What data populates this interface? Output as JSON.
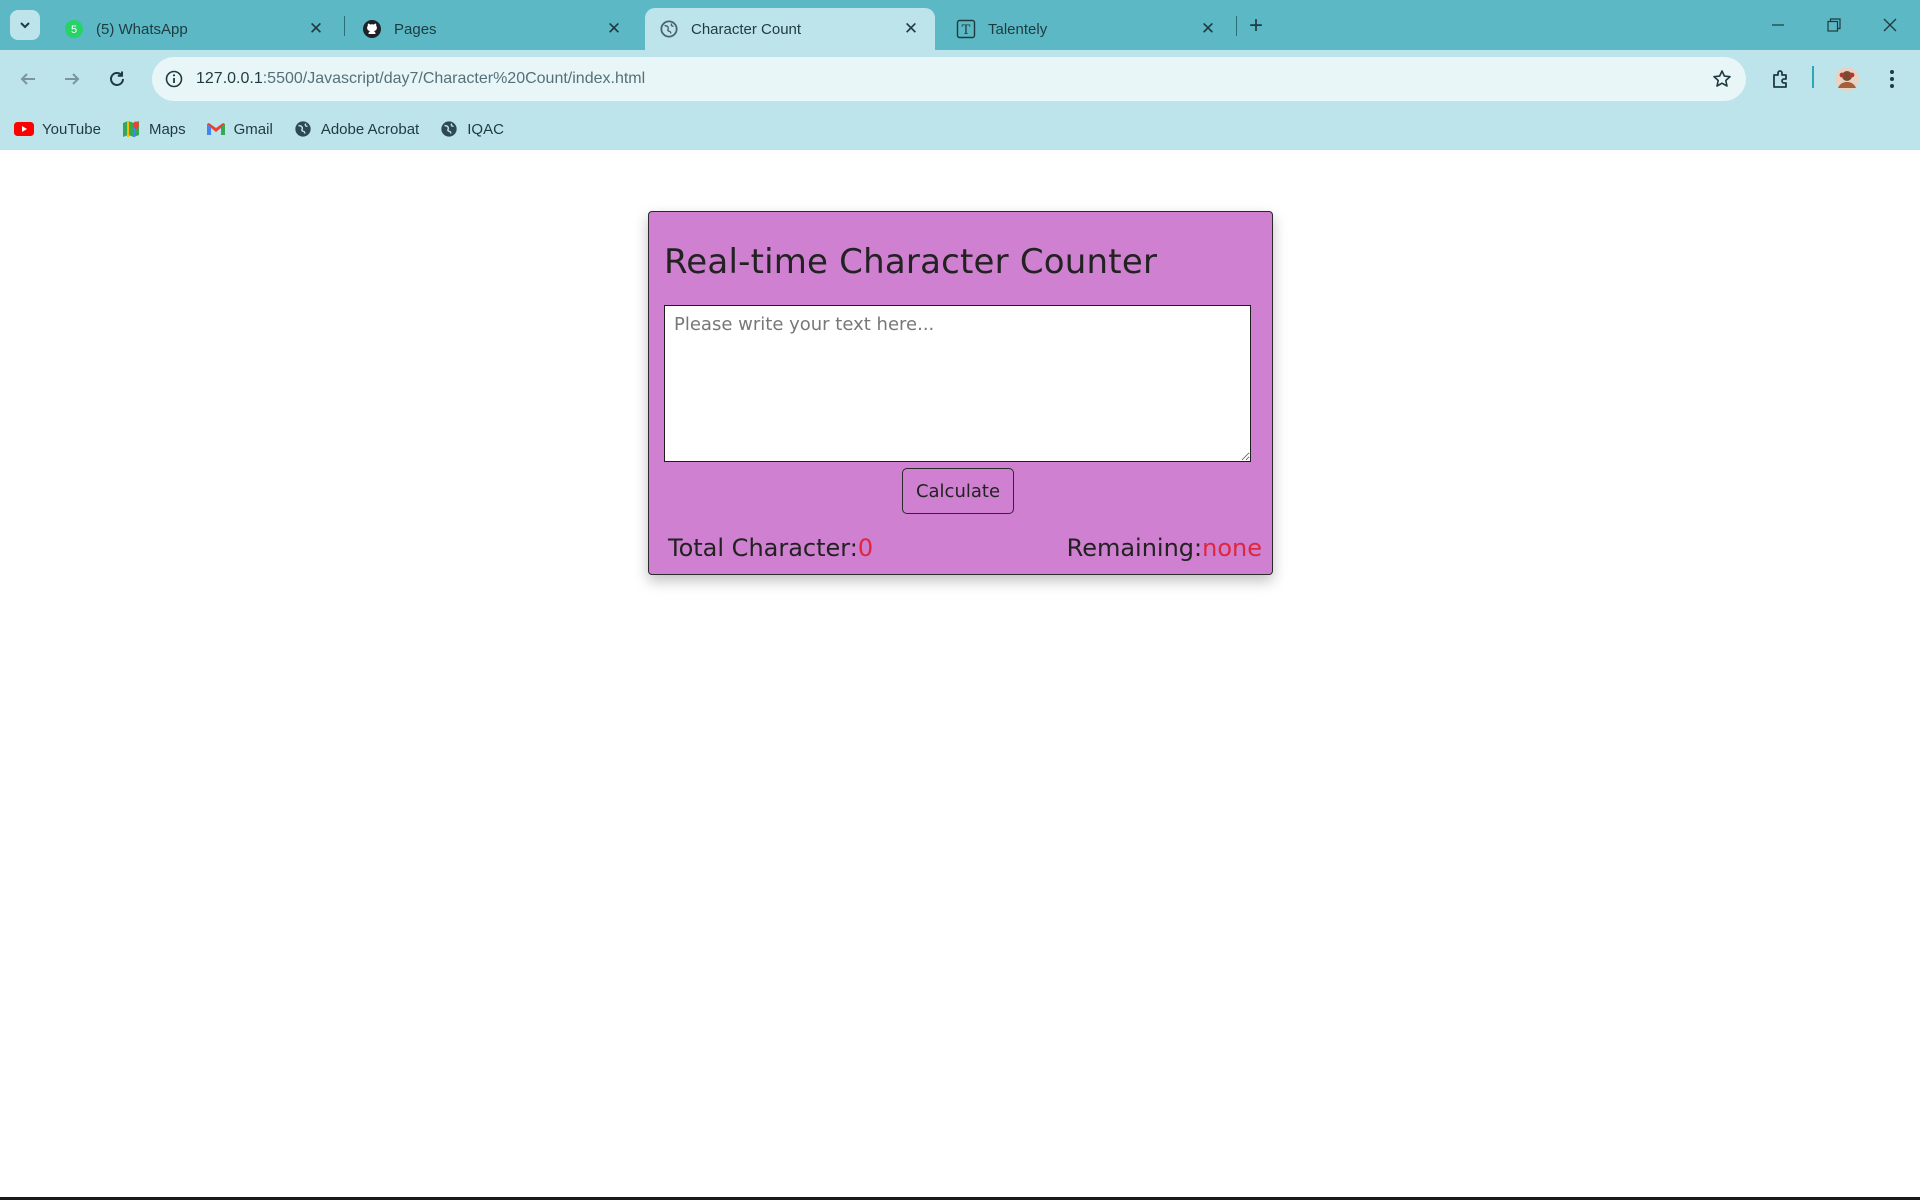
{
  "browser": {
    "tabs": [
      {
        "title": "(5) WhatsApp",
        "icon": "whatsapp-icon",
        "badge": "5",
        "active": false
      },
      {
        "title": "Pages",
        "icon": "github-icon",
        "active": false
      },
      {
        "title": "Character Count",
        "icon": "globe-icon",
        "active": true
      },
      {
        "title": "Talentely",
        "icon": "talentely-icon",
        "active": false
      }
    ],
    "url_host": "127.0.0.1",
    "url_path": ":5500/Javascript/day7/Character%20Count/index.html",
    "bookmarks": [
      {
        "label": "YouTube",
        "icon": "youtube-icon"
      },
      {
        "label": "Maps",
        "icon": "maps-icon"
      },
      {
        "label": "Gmail",
        "icon": "gmail-icon"
      },
      {
        "label": "Adobe Acrobat",
        "icon": "globe-icon"
      },
      {
        "label": "IQAC",
        "icon": "globe-icon"
      }
    ],
    "colors": {
      "tabstrip": "#5bb8c4",
      "toolbar": "#bde4ea"
    }
  },
  "app": {
    "heading": "Real-time Character Counter",
    "textarea_placeholder": "Please write your text here...",
    "textarea_value": "",
    "calculate_label": "Calculate",
    "total_label": "Total Character:",
    "total_value": "0",
    "remaining_label": "Remaining:",
    "remaining_value": "none",
    "colors": {
      "card": "#cf80d0",
      "value": "#e0263c"
    }
  }
}
